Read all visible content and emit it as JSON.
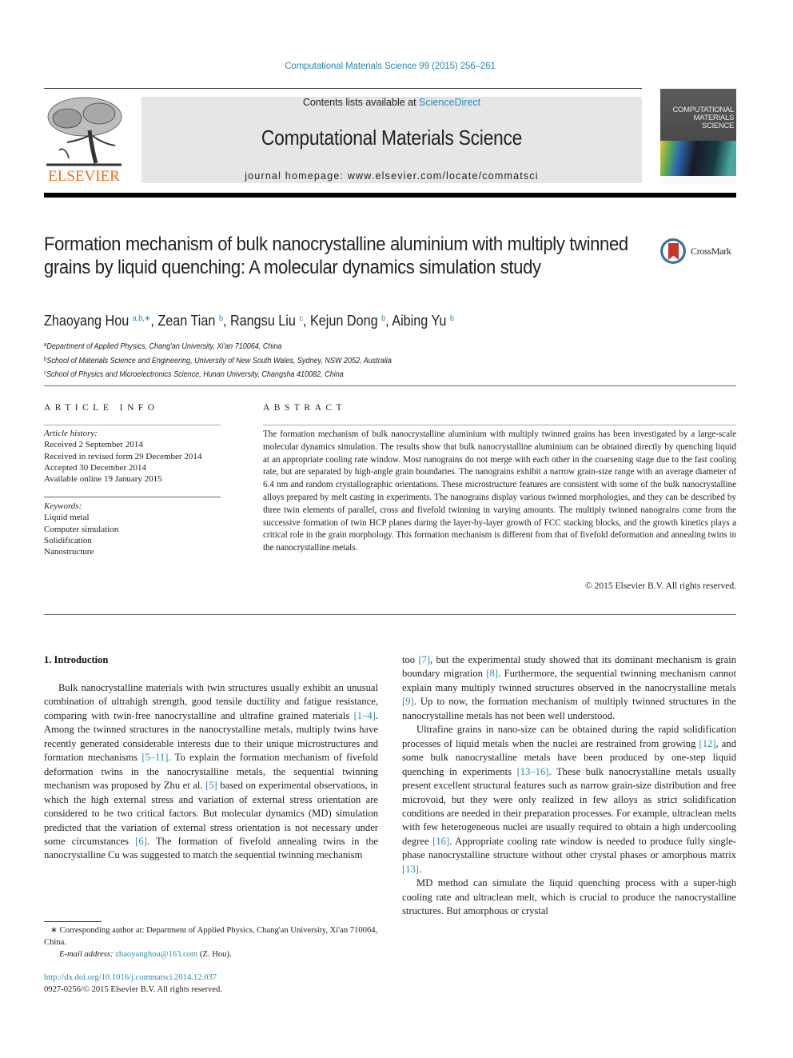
{
  "header": {
    "citation": "Computational Materials Science 99 (2015) 256–261",
    "contents_prefix": "Contents lists available at ",
    "contents_link": "ScienceDirect",
    "journal_title": "Computational Materials Science",
    "homepage": "journal homepage: www.elsevier.com/locate/commatsci",
    "publisher_logo_text": "ELSEVIER",
    "cover_title_lines": [
      "COMPUTATIONAL",
      "MATERIALS",
      "SCIENCE"
    ],
    "colors": {
      "link": "#2a8ab5",
      "elsevier_orange": "#e9711c",
      "banner_bg": "#e6e6e6"
    }
  },
  "article": {
    "title": "Formation mechanism of bulk nanocrystalline aluminium with multiply twinned grains by liquid quenching: A molecular dynamics simulation study",
    "crossmark_label": "CrossMark",
    "authors": [
      {
        "name": "Zhaoyang Hou",
        "sup": "a,b,∗",
        "sep": ", "
      },
      {
        "name": "Zean Tian",
        "sup": "b",
        "sep": ", "
      },
      {
        "name": "Rangsu Liu",
        "sup": "c",
        "sep": ", "
      },
      {
        "name": "Kejun Dong",
        "sup": "b",
        "sep": ", "
      },
      {
        "name": "Aibing Yu",
        "sup": "b",
        "sep": ""
      }
    ],
    "affiliations": [
      {
        "sup": "a",
        "text": "Department of Applied Physics, Chang'an University, Xi'an 710064, China"
      },
      {
        "sup": "b",
        "text": "School of Materials Science and Engineering, University of New South Wales, Sydney, NSW 2052, Australia"
      },
      {
        "sup": "c",
        "text": "School of Physics and Microelectronics Science, Hunan University, Changsha 410082, China"
      }
    ]
  },
  "article_info": {
    "heading": "ARTICLE INFO",
    "history_label": "Article history:",
    "history": [
      "Received 2 September 2014",
      "Received in revised form 29 December 2014",
      "Accepted 30 December 2014",
      "Available online 19 January 2015"
    ],
    "keywords_label": "Keywords:",
    "keywords": [
      "Liquid metal",
      "Computer simulation",
      "Solidification",
      "Nanostructure"
    ]
  },
  "abstract": {
    "heading": "ABSTRACT",
    "text": "The formation mechanism of bulk nanocrystalline aluminium with multiply twinned grains has been investigated by a large-scale molecular dynamics simulation. The results show that bulk nanocrystalline aluminium can be obtained directly by quenching liquid at an appropriate cooling rate window. Most nanograins do not merge with each other in the coarsening stage due to the fast cooling rate, but are separated by high-angle grain boundaries. The nanograins exhibit a narrow grain-size range with an average diameter of 6.4 nm and random crystallographic orientations. These microstructure features are consistent with some of the bulk nanocrystalline alloys prepared by melt casting in experiments. The nanograins display various twinned morphologies, and they can be described by three twin elements of parallel, cross and fivefold twinning in varying amounts. The multiply twinned nanograins come from the successive formation of twin HCP planes during the layer-by-layer growth of FCC stacking blocks, and the growth kinetics plays a critical role in the grain morphology. This formation mechanism is different from that of fivefold deformation and annealing twins in the nanocrystalline metals.",
    "copyright": "© 2015 Elsevier B.V. All rights reserved."
  },
  "body": {
    "section_heading": "1. Introduction",
    "left_paragraphs": [
      [
        {
          "t": "Bulk nanocrystalline materials with twin structures usually exhibit an unusual combination of ultrahigh strength, good tensile ductility and fatigue resistance, comparing with twin-free nanocrystalline and ultrafine grained materials "
        },
        {
          "ref": "[1–4]"
        },
        {
          "t": ". Among the twinned structures in the nanocrystalline metals, multiply twins have recently generated considerable interests due to their unique microstructures and formation mechanisms "
        },
        {
          "ref": "[5–11]"
        },
        {
          "t": ". To explain the formation mechanism of fivefold deformation twins in the nanocrystalline metals, the sequential twinning mechanism was proposed by Zhu et al. "
        },
        {
          "ref": "[5]"
        },
        {
          "t": " based on experimental observations, in which the high external stress and variation of external stress orientation are considered to be two critical factors. But molecular dynamics (MD) simulation predicted that the variation of external stress orientation is not necessary under some circumstances "
        },
        {
          "ref": "[6]"
        },
        {
          "t": ". The formation of fivefold annealing twins in the nanocrystalline Cu was suggested to match the sequential twinning mechanism"
        }
      ]
    ],
    "right_paragraphs": [
      [
        {
          "t": "too "
        },
        {
          "ref": "[7]"
        },
        {
          "t": ", but the experimental study showed that its dominant mechanism is grain boundary migration "
        },
        {
          "ref": "[8]"
        },
        {
          "t": ". Furthermore, the sequential twinning mechanism cannot explain many multiply twinned structures observed in the nanocrystalline metals "
        },
        {
          "ref": "[9]"
        },
        {
          "t": ". Up to now, the formation mechanism of multiply twinned structures in the nanocrystalline metals has not been well understood."
        }
      ],
      [
        {
          "t": "Ultrafine grains in nano-size can be obtained during the rapid solidification processes of liquid metals when the nuclei are restrained from growing "
        },
        {
          "ref": "[12]"
        },
        {
          "t": ", and some bulk nanocrystalline metals have been produced by one-step liquid quenching in experiments "
        },
        {
          "ref": "[13–16]"
        },
        {
          "t": ". These bulk nanocrystalline metals usually present excellent structural features such as narrow grain-size distribution and free microvoid, but they were only realized in few alloys as strict solidification conditions are needed in their preparation processes. For example, ultraclean melts with few heterogeneous nuclei are usually required to obtain a high undercooling degree "
        },
        {
          "ref": "[16]"
        },
        {
          "t": ". Appropriate cooling rate window is needed to produce fully single-phase nanocrystalline structure without other crystal phases or amorphous matrix "
        },
        {
          "ref": "[13]"
        },
        {
          "t": "."
        }
      ],
      [
        {
          "t": "MD method can simulate the liquid quenching process with a super-high cooling rate and ultraclean melt, which is crucial to produce the nanocrystalline structures. But amorphous or crystal"
        }
      ]
    ]
  },
  "footer": {
    "corresponding": "∗ Corresponding author at: Department of Applied Physics, Chang'an University, Xi'an 710064, China.",
    "email_label": "E-mail address:",
    "email": "zhaoyanghou@163.com",
    "email_suffix": " (Z. Hou).",
    "doi": "http://dx.doi.org/10.1016/j.commatsci.2014.12.037",
    "issn_line": "0927-0256/© 2015 Elsevier B.V. All rights reserved."
  }
}
